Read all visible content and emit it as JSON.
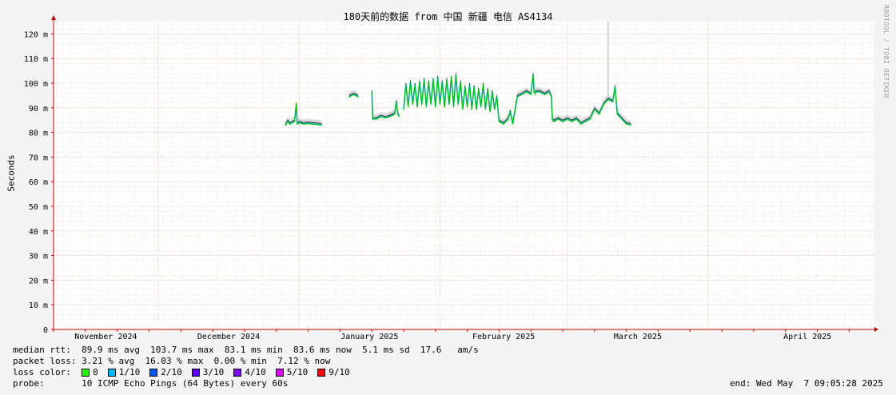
{
  "title": "180天前的数据 from 中国 新疆 电信 AS4134",
  "watermark": "RRDTOOL / TOBI OETIKER",
  "chart_data": {
    "type": "line",
    "ylabel": "Seconds",
    "ylim": [
      0,
      125
    ],
    "yticks": [
      {
        "value": 0,
        "label": "0"
      },
      {
        "value": 10,
        "label": "10 m"
      },
      {
        "value": 20,
        "label": "20 m"
      },
      {
        "value": 30,
        "label": "30 m"
      },
      {
        "value": 40,
        "label": "40 m"
      },
      {
        "value": 50,
        "label": "50 m"
      },
      {
        "value": 60,
        "label": "60 m"
      },
      {
        "value": 70,
        "label": "70 m"
      },
      {
        "value": 80,
        "label": "80 m"
      },
      {
        "value": 90,
        "label": "90 m"
      },
      {
        "value": 100,
        "label": "100 m"
      },
      {
        "value": 110,
        "label": "110 m"
      },
      {
        "value": 120,
        "label": "120 m"
      }
    ],
    "x_range": [
      "2024-11-08",
      "2025-05-07"
    ],
    "months": [
      {
        "label": "November 2024",
        "date": "2024-11-01"
      },
      {
        "label": "December 2024",
        "date": "2024-12-01"
      },
      {
        "label": "January 2025",
        "date": "2025-01-01"
      },
      {
        "label": "February 2025",
        "date": "2025-02-01"
      },
      {
        "label": "March 2025",
        "date": "2025-03-01"
      },
      {
        "label": "April 2025",
        "date": "2025-04-01"
      }
    ],
    "grid": true,
    "series": [
      {
        "name": "median rtt",
        "color": "#00c000",
        "segments": [
          {
            "start": "2024-12-29",
            "end": "2025-01-06",
            "points": [
              [
                0,
                83.5
              ],
              [
                0.5,
                85
              ],
              [
                1,
                84
              ],
              [
                2,
                85
              ],
              [
                2.4,
                92
              ],
              [
                2.6,
                84
              ],
              [
                3,
                84.5
              ],
              [
                4,
                84
              ],
              [
                5,
                84.2
              ],
              [
                6,
                84
              ],
              [
                7,
                83.8
              ],
              [
                8,
                83.6
              ]
            ]
          },
          {
            "start": "2025-01-12",
            "end": "2025-01-14",
            "points": [
              [
                0,
                95
              ],
              [
                1,
                96
              ],
              [
                2,
                95
              ]
            ]
          },
          {
            "start": "2025-01-17",
            "end": "2025-01-23",
            "points": [
              [
                0,
                97
              ],
              [
                0.2,
                86
              ],
              [
                1,
                86
              ],
              [
                2,
                87
              ],
              [
                3,
                86.5
              ],
              [
                4,
                87
              ],
              [
                5,
                88
              ],
              [
                5.4,
                93
              ],
              [
                5.7,
                88
              ],
              [
                6,
                87
              ]
            ]
          },
          {
            "start": "2025-01-24",
            "end": "2025-02-22",
            "points": [
              [
                0,
                90
              ],
              [
                0.5,
                100
              ],
              [
                1,
                91
              ],
              [
                1.5,
                101
              ],
              [
                2,
                92
              ],
              [
                2.5,
                100
              ],
              [
                3,
                91
              ],
              [
                3.5,
                101
              ],
              [
                4,
                92
              ],
              [
                4.5,
                102
              ],
              [
                5,
                91
              ],
              [
                5.5,
                101
              ],
              [
                6,
                92
              ],
              [
                6.5,
                102
              ],
              [
                7,
                91
              ],
              [
                7.5,
                103
              ],
              [
                8,
                92
              ],
              [
                8.5,
                101
              ],
              [
                9,
                91
              ],
              [
                9.5,
                102
              ],
              [
                10,
                92
              ],
              [
                10.5,
                103
              ],
              [
                11,
                91
              ],
              [
                11.5,
                104
              ],
              [
                12,
                92
              ],
              [
                12.5,
                101
              ],
              [
                13,
                90
              ],
              [
                13.5,
                99
              ],
              [
                14,
                91
              ],
              [
                14.5,
                100
              ],
              [
                15,
                90
              ],
              [
                15.5,
                99
              ],
              [
                16,
                90
              ],
              [
                16.5,
                98
              ],
              [
                17,
                91
              ],
              [
                17.5,
                100
              ],
              [
                18,
                90
              ],
              [
                18.5,
                98
              ],
              [
                19,
                89
              ],
              [
                19.5,
                97
              ],
              [
                20,
                90
              ],
              [
                20.5,
                95
              ],
              [
                21,
                85
              ],
              [
                22,
                84
              ],
              [
                23,
                86
              ],
              [
                23.5,
                89
              ],
              [
                24,
                84
              ],
              [
                25,
                95
              ],
              [
                26,
                96
              ],
              [
                27,
                97
              ],
              [
                28,
                96
              ],
              [
                28.5,
                104
              ],
              [
                28.7,
                97
              ],
              [
                29,
                96
              ]
            ]
          },
          {
            "start": "2025-02-22",
            "end": "2025-03-01",
            "points": [
              [
                0,
                97
              ],
              [
                1,
                97
              ],
              [
                2,
                96
              ],
              [
                3,
                97
              ],
              [
                3.5,
                95
              ],
              [
                3.7,
                86
              ],
              [
                4,
                85
              ],
              [
                5,
                86
              ],
              [
                6,
                85
              ],
              [
                7,
                86
              ]
            ]
          },
          {
            "start": "2025-03-01",
            "end": "2025-03-15",
            "points": [
              [
                0,
                86
              ],
              [
                1,
                85
              ],
              [
                2,
                86
              ],
              [
                3,
                84
              ],
              [
                4,
                85
              ],
              [
                5,
                86
              ],
              [
                6,
                90
              ],
              [
                7,
                88
              ],
              [
                8,
                92
              ],
              [
                9,
                94
              ],
              [
                10,
                93
              ],
              [
                10.5,
                99
              ],
              [
                11,
                88
              ],
              [
                12,
                86
              ],
              [
                13,
                84
              ],
              [
                14,
                83.6
              ]
            ]
          }
        ]
      }
    ],
    "spikes": [
      {
        "date": "2025-03-10",
        "value": 125
      }
    ]
  },
  "stats": {
    "median_line": "median rtt:  89.9 ms avg  103.7 ms max  83.1 ms min  83.6 ms now  5.1 ms sd  17.6   am/s",
    "loss_line": "packet loss: 3.21 % avg  16.03 % max  0.00 % min  7.12 % now"
  },
  "loss_legend": {
    "label": "loss color:",
    "items": [
      {
        "label": "0",
        "color": "#26ff00"
      },
      {
        "label": "1/10",
        "color": "#00b8ff"
      },
      {
        "label": "2/10",
        "color": "#0059ff"
      },
      {
        "label": "3/10",
        "color": "#5e00ff"
      },
      {
        "label": "4/10",
        "color": "#7e00ff"
      },
      {
        "label": "5/10",
        "color": "#dd00ff"
      },
      {
        "label": "9/10",
        "color": "#ff0000"
      }
    ]
  },
  "probe": "probe:       10 ICMP Echo Pings (64 Bytes) every 60s",
  "end_time": "end: Wed May  7 09:05:28 2025"
}
